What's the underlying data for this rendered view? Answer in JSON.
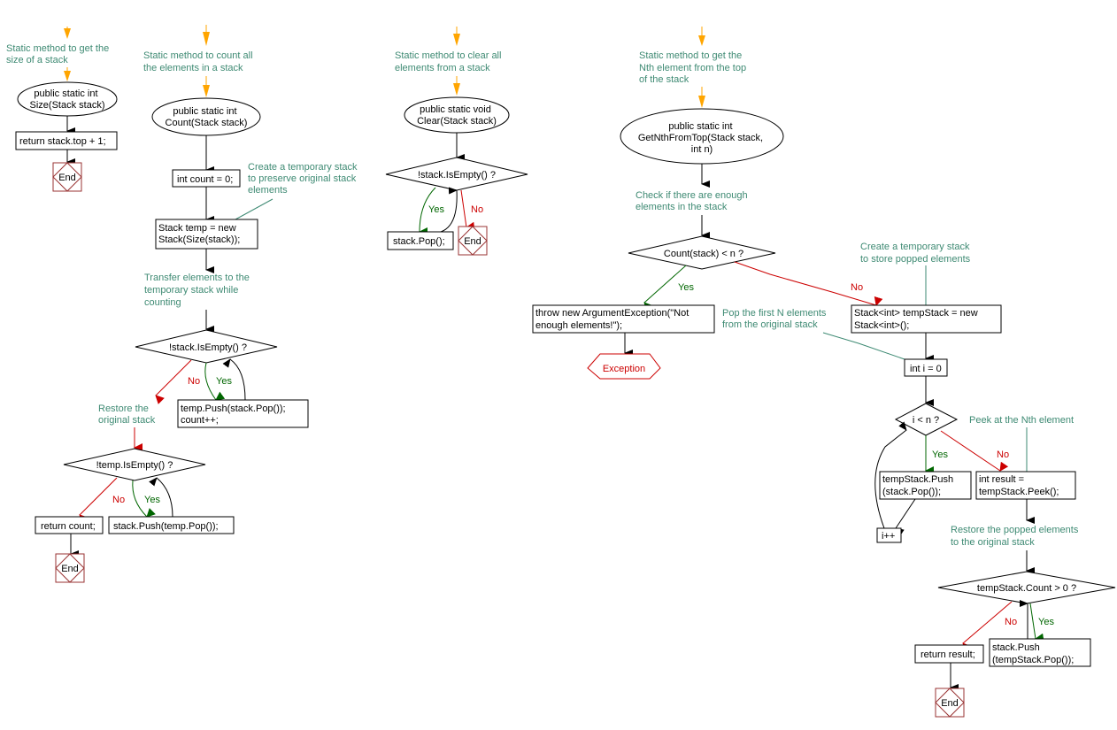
{
  "colors": {
    "comment": "#3e8a73",
    "no_branch": "#cc0000",
    "yes_branch": "#006600",
    "entry_arrow": "#ffa500",
    "end_box": "#993333",
    "exception": "#cc0000"
  },
  "flow_size": {
    "comment": [
      "Static method to get the",
      "size of a stack"
    ],
    "start": [
      "public static int",
      "Size(Stack stack)"
    ],
    "step1": "return stack.top + 1;",
    "end": "End"
  },
  "flow_count": {
    "comment": [
      "Static method to count all",
      "the elements in a stack"
    ],
    "start": [
      "public static int",
      "Count(Stack stack)"
    ],
    "step1": "int count = 0;",
    "note1": [
      "Create a temporary stack",
      "to preserve original stack",
      "elements"
    ],
    "step2": [
      "Stack temp = new",
      "Stack(Size(stack));"
    ],
    "note2": [
      "Transfer elements to the",
      "temporary stack while",
      "counting"
    ],
    "decision1": "!stack.IsEmpty() ?",
    "no": "No",
    "yes": "Yes",
    "loop1_body": [
      "temp.Push(stack.Pop());",
      "count++;"
    ],
    "note3": [
      "Restore the",
      "original stack"
    ],
    "decision2": "!temp.IsEmpty() ?",
    "no2": "No",
    "yes2": "Yes",
    "loop2_body": "stack.Push(temp.Pop());",
    "return": "return count;",
    "end": "End"
  },
  "flow_clear": {
    "comment": [
      "Static method to clear all",
      "elements from a stack"
    ],
    "start": [
      "public static void",
      "Clear(Stack stack)"
    ],
    "decision": "!stack.IsEmpty() ?",
    "yes": "Yes",
    "no": "No",
    "loop_body": "stack.Pop();",
    "end": "End"
  },
  "flow_nth": {
    "comment": [
      "Static method to get the",
      "Nth element from the top",
      "of the stack"
    ],
    "start": [
      "public static int",
      "GetNthFromTop(Stack stack,",
      "int n)"
    ],
    "note_check": [
      "Check if there are enough",
      "elements in the stack"
    ],
    "decision1": "Count(stack) < n ?",
    "yes1": "Yes",
    "no1": "No",
    "throw": [
      "throw new ArgumentException(\"Not",
      "enough elements!\");"
    ],
    "exception": "Exception",
    "note_temp": [
      "Create a temporary stack",
      "to store popped elements"
    ],
    "create_temp": [
      "Stack<int> tempStack = new",
      "Stack<int>();"
    ],
    "note_pop": [
      "Pop the first N elements",
      "from the original stack"
    ],
    "init_i": "int i = 0",
    "decision2": "i < n ?",
    "yes2": "Yes",
    "no2": "No",
    "push_temp": [
      "tempStack.Push",
      "(stack.Pop());"
    ],
    "incr": "i++",
    "note_peek": "Peek at the Nth element",
    "peek": [
      "int result =",
      "tempStack.Peek();"
    ],
    "note_restore": [
      "Restore the popped elements",
      "to the original stack"
    ],
    "decision3": "tempStack.Count > 0 ?",
    "no3": "No",
    "yes3": "Yes",
    "restore_body": [
      "stack.Push",
      "(tempStack.Pop());"
    ],
    "return": "return result;",
    "end": "End"
  }
}
